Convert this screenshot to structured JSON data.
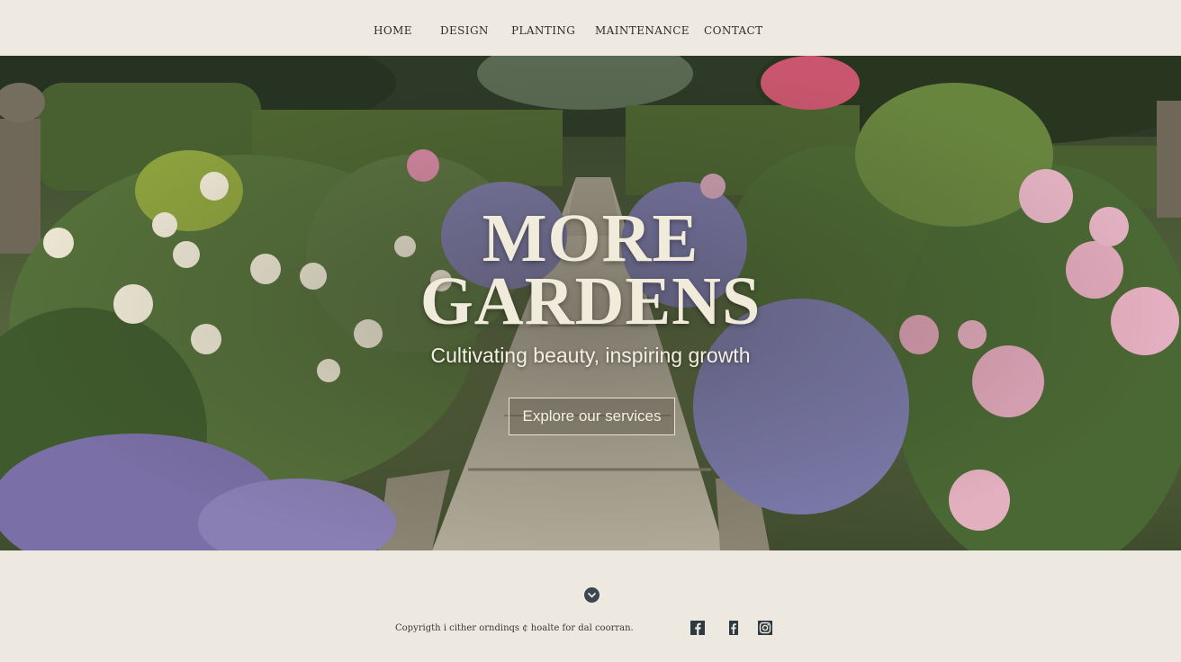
{
  "nav": {
    "items": [
      "HOME",
      "DESIGN",
      "PLANTING",
      "MAINTENANCE",
      "CONTACT"
    ]
  },
  "hero": {
    "title_line1": "MORE",
    "title_line2": "GARDENS",
    "tagline": "Cultivating beauty, inspiring growth",
    "cta_label": "Explore our services"
  },
  "footer": {
    "copyright": "Copyrigth i cither orndinqs ¢ hoalte for dal coorran.",
    "scroll_icon": "chevron-down-icon",
    "social": [
      {
        "name": "facebook",
        "icon": "facebook-icon"
      },
      {
        "name": "facebook-alt",
        "icon": "facebook-icon"
      },
      {
        "name": "instagram",
        "icon": "instagram-icon"
      }
    ]
  },
  "colors": {
    "background": "#ede9e0",
    "nav_text": "#2f2d29",
    "hero_text": "#f1ebdb",
    "icon": "#2f3942"
  }
}
